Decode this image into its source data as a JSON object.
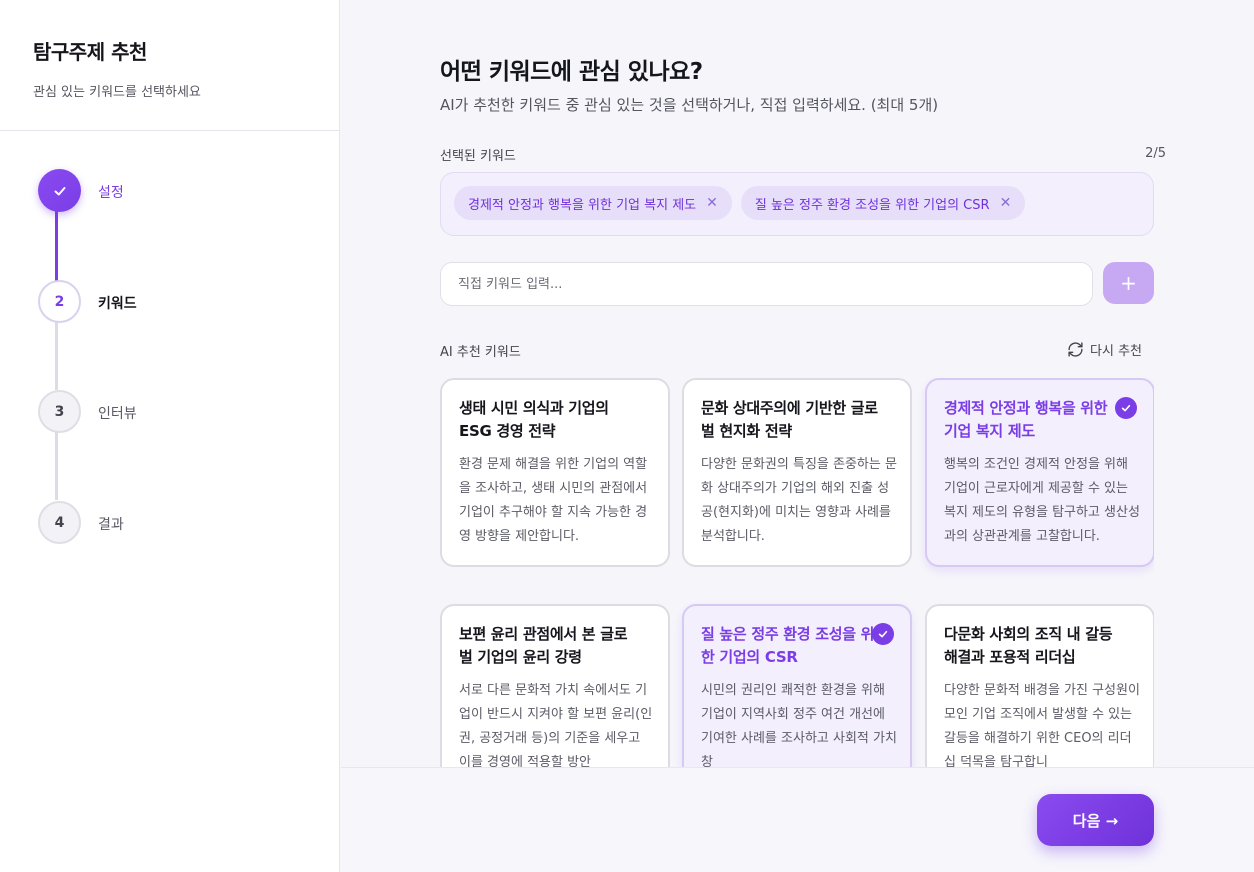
{
  "sidebar": {
    "title": "탐구주제 추천",
    "subtitle": "관심 있는 키워드를 선택하세요",
    "steps": [
      {
        "number": "",
        "label": "설정",
        "state": "done",
        "icon": "check-icon"
      },
      {
        "number": "2",
        "label": "키워드",
        "state": "active"
      },
      {
        "number": "3",
        "label": "인터뷰",
        "state": "todo"
      },
      {
        "number": "4",
        "label": "결과",
        "state": "todo"
      }
    ]
  },
  "main": {
    "heading": "어떤 키워드에 관심 있나요?",
    "subheading": "AI가 추천한 키워드 중 관심 있는 것을 선택하거나, 직접 입력하세요. (최대 5개)",
    "selected_label": "선택된 키워드",
    "selected_count": "2/5",
    "selected_chips": [
      "경제적 안정과 행복을 위한 기업 복지 제도",
      "질 높은 정주 환경 조성을 위한 기업의 CSR"
    ],
    "input_placeholder": "직접 키워드 입력...",
    "add_button": "+",
    "ai_label": "AI 추천 키워드",
    "refresh_label": "다시 추천",
    "cards": [
      {
        "title": "생태 시민 의식과 기업의 ESG 경영 전략",
        "desc": "환경 문제 해결을 위한 기업의 역할을 조사하고, 생태 시민의 관점에서 기업이 추구해야 할 지속 가능한 경영 방향을 제안합니다.",
        "selected": false
      },
      {
        "title": "문화 상대주의에 기반한 글로벌 현지화 전략",
        "desc": "다양한 문화권의 특징을 존중하는 문화 상대주의가 기업의 해외 진출 성공(현지화)에 미치는 영향과 사례를 분석합니다.",
        "selected": false
      },
      {
        "title": "경제적 안정과 행복을 위한 기업 복지 제도",
        "desc": "행복의 조건인 경제적 안정을 위해 기업이 근로자에게 제공할 수 있는 복지 제도의 유형을 탐구하고 생산성과의 상관관계를 고찰합니다.",
        "selected": true
      },
      {
        "title": "보편 윤리 관점에서 본 글로벌 기업의 윤리 강령",
        "desc": "서로 다른 문화적 가치 속에서도 기업이 반드시 지켜야 할 보편 윤리(인권, 공정거래 등)의 기준을 세우고 이를 경영에 적용할 방안",
        "selected": false
      },
      {
        "title": "질 높은 정주 환경 조성을 위한 기업의 CSR",
        "desc": "시민의 권리인 쾌적한 환경을 위해 기업이 지역사회 정주 여건 개선에 기여한 사례를 조사하고 사회적 가치 창",
        "selected": true
      },
      {
        "title": "다문화 사회의 조직 내 갈등 해결과 포용적 리더십",
        "desc": "다양한 문화적 배경을 가진 구성원이 모인 기업 조직에서 발생할 수 있는 갈등을 해결하기 위한 CEO의 리더십 덕목을 탐구합니",
        "selected": false
      }
    ],
    "next_button": "다음 →"
  },
  "colors": {
    "accent": "#7a3de6",
    "chip_bg": "#e7defa",
    "selected_card_bg": "#f3effc"
  }
}
